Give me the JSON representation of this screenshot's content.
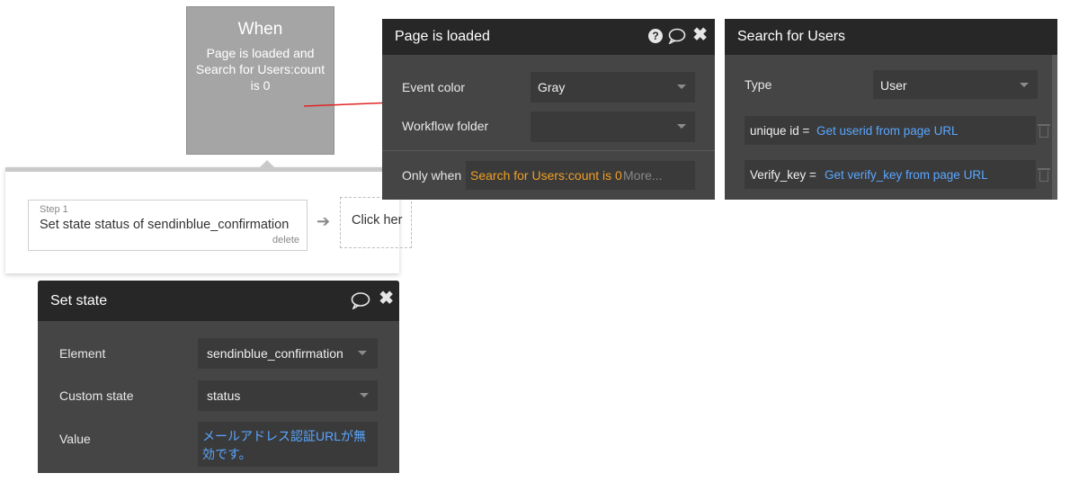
{
  "when": {
    "title": "When",
    "condition": "Page is loaded and Search for Users:count is 0"
  },
  "workflow": {
    "step": {
      "number": "Step 1",
      "title": "Set state status of sendinblue_confirmation",
      "delete_label": "delete"
    },
    "click_here": "Click her"
  },
  "page_loaded_panel": {
    "title": "Page is loaded",
    "icons": [
      "help-icon",
      "comment-icon",
      "close-icon"
    ],
    "event_color_label": "Event color",
    "event_color_value": "Gray",
    "workflow_folder_label": "Workflow folder",
    "workflow_folder_value": "",
    "only_when_label": "Only when",
    "only_when_expression": "Search for Users:count is 0",
    "more_label": "More..."
  },
  "search_users_panel": {
    "title": "Search for Users",
    "type_label": "Type",
    "type_value": "User",
    "constraints": [
      {
        "key": "unique id =",
        "value": "Get userid from page URL"
      },
      {
        "key": "Verify_key =",
        "value": "Get verify_key from page URL"
      }
    ]
  },
  "set_state_panel": {
    "title": "Set state",
    "icons": [
      "comment-icon",
      "close-icon"
    ],
    "element_label": "Element",
    "element_value": "sendinblue_confirmation",
    "custom_state_label": "Custom state",
    "custom_state_value": "status",
    "value_label": "Value",
    "value_text": "メールアドレス認証URLが無効です。"
  },
  "colors": {
    "panel_bg": "#454545",
    "panel_header": "#272727",
    "dynamic_orange": "#f0a024",
    "dynamic_blue": "#5aa6ff",
    "connector_red": "#e02424",
    "when_box": "#a5a5a5"
  }
}
